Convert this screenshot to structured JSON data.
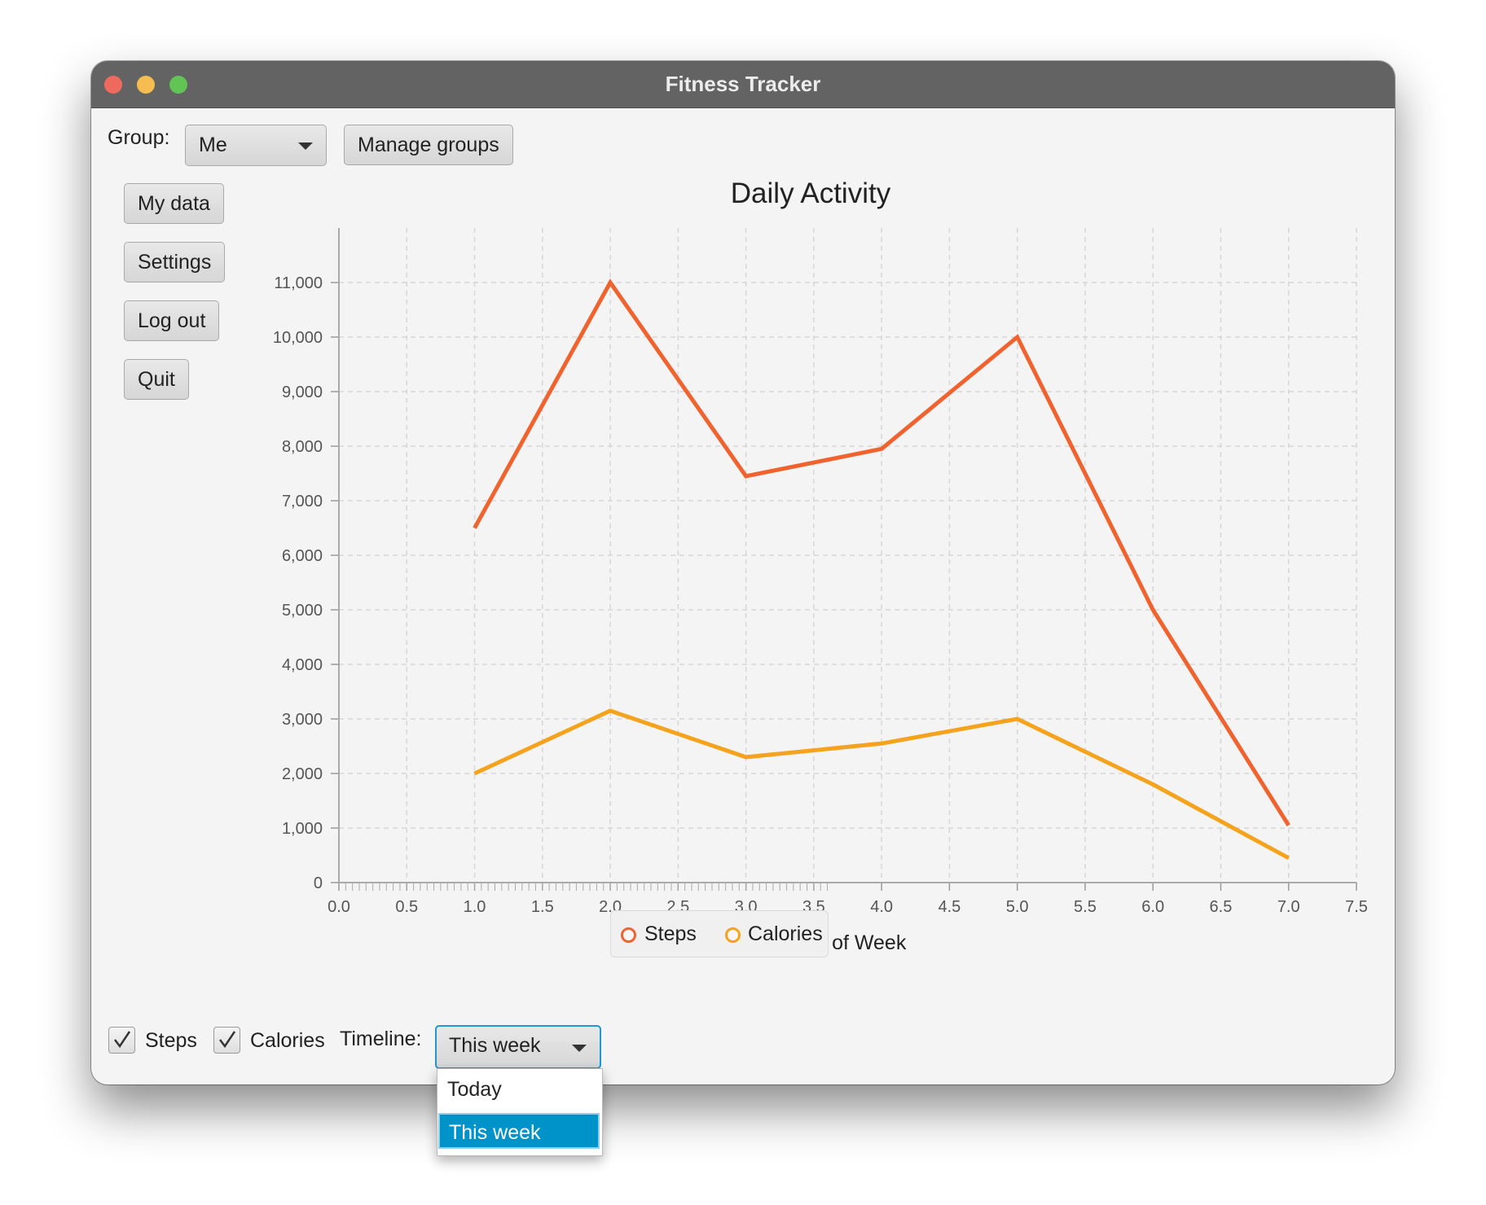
{
  "window": {
    "title": "Fitness Tracker"
  },
  "top_bar": {
    "group_label": "Group:",
    "group_value": "Me",
    "manage_groups_label": "Manage groups"
  },
  "sidebar": {
    "buttons": [
      "My data",
      "Settings",
      "Log out",
      "Quit"
    ]
  },
  "bottom_bar": {
    "steps_label": "Steps",
    "steps_checked": true,
    "calories_label": "Calories",
    "calories_checked": true,
    "timeline_label": "Timeline:",
    "timeline_value": "This week"
  },
  "timeline_popup": {
    "options": [
      "Today",
      "This week"
    ],
    "selected": "This week"
  },
  "colors": {
    "steps": "#f0622e",
    "calories": "#f5a21c",
    "selection": "#0093c9",
    "focus": "#1e97d4"
  },
  "chart_data": {
    "type": "line",
    "title": "Daily Activity",
    "xlabel": "Day of Week",
    "ylabel": "",
    "xlim": [
      0,
      7.5
    ],
    "ylim": [
      0,
      12000
    ],
    "x_ticks": [
      "0.0",
      "0.5",
      "1.0",
      "1.5",
      "2.0",
      "2.5",
      "3.0",
      "3.5",
      "4.0",
      "4.5",
      "5.0",
      "5.5",
      "6.0",
      "6.5",
      "7.0",
      "7.5"
    ],
    "y_ticks": [
      "0",
      "1,000",
      "2,000",
      "3,000",
      "4,000",
      "5,000",
      "6,000",
      "7,000",
      "8,000",
      "9,000",
      "10,000",
      "11,000"
    ],
    "grid": true,
    "legend_position": "bottom",
    "series": [
      {
        "name": "Steps",
        "color": "#f0622e",
        "x": [
          1,
          2,
          3,
          4,
          5,
          6,
          7
        ],
        "y": [
          6500,
          11000,
          7450,
          7950,
          10000,
          5000,
          1050
        ]
      },
      {
        "name": "Calories",
        "color": "#f5a21c",
        "x": [
          1,
          2,
          3,
          4,
          5,
          6,
          7
        ],
        "y": [
          2000,
          3150,
          2300,
          2550,
          3000,
          1800,
          450
        ]
      }
    ]
  }
}
